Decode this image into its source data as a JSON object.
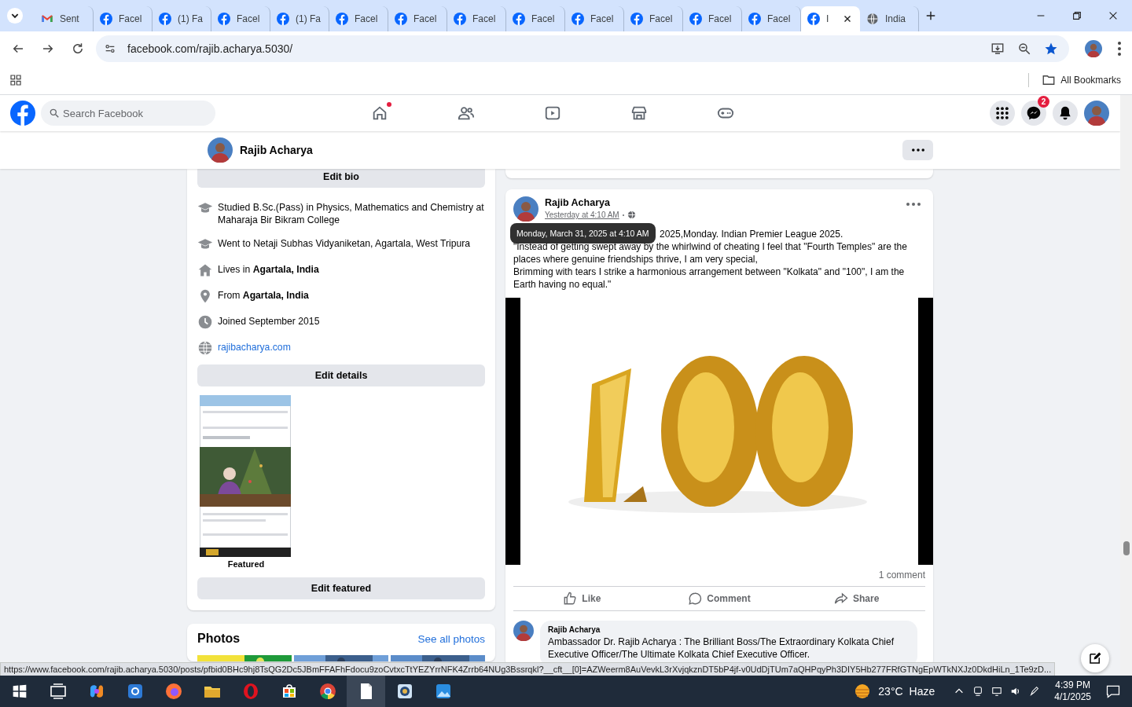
{
  "browser": {
    "tabs": [
      {
        "kind": "gmail",
        "title": "Sent",
        "selected": false
      },
      {
        "kind": "facebook",
        "title": "Facel",
        "selected": false
      },
      {
        "kind": "facebook",
        "title": "(1) Fa",
        "selected": false
      },
      {
        "kind": "facebook",
        "title": "Facel",
        "selected": false
      },
      {
        "kind": "facebook",
        "title": "(1) Fa",
        "selected": false
      },
      {
        "kind": "facebook",
        "title": "Facel",
        "selected": false
      },
      {
        "kind": "facebook",
        "title": "Facel",
        "selected": false
      },
      {
        "kind": "facebook",
        "title": "Facel",
        "selected": false
      },
      {
        "kind": "facebook",
        "title": "Facel",
        "selected": false
      },
      {
        "kind": "facebook",
        "title": "Facel",
        "selected": false
      },
      {
        "kind": "facebook",
        "title": "Facel",
        "selected": false
      },
      {
        "kind": "facebook",
        "title": "Facel",
        "selected": false
      },
      {
        "kind": "facebook",
        "title": "Facel",
        "selected": false
      },
      {
        "kind": "facebook",
        "title": "I",
        "selected": true
      },
      {
        "kind": "globe",
        "title": "India",
        "selected": false
      }
    ],
    "address": "facebook.com/rajib.acharya.5030/",
    "bookmarks_folder": "All Bookmarks"
  },
  "facebook": {
    "search": {
      "placeholder": "Search Facebook"
    },
    "nav": [
      {
        "kind": "home",
        "dot": true
      },
      {
        "kind": "friends",
        "dot": false
      },
      {
        "kind": "video",
        "dot": false
      },
      {
        "kind": "market",
        "dot": false
      },
      {
        "kind": "gaming",
        "dot": false
      }
    ],
    "messenger_badge": "2"
  },
  "profile_bar": {
    "name": "Rajib Acharya"
  },
  "intro": {
    "edit_bio": "Edit bio",
    "items": [
      {
        "kind": "education",
        "text": "Studied B.Sc.(Pass) in Physics, Mathematics and Chemistry at Maharaja Bir Bikram College"
      },
      {
        "kind": "education",
        "text": "Went to Netaji Subhas Vidyaniketan, Agartala, West Tripura"
      },
      {
        "kind": "home",
        "text": "Lives in **Agartala, India**"
      },
      {
        "kind": "location",
        "text": "From **Agartala, India**"
      },
      {
        "kind": "clock",
        "text": "Joined September 2015"
      },
      {
        "kind": "website",
        "text": "rajibacharya.com"
      }
    ],
    "edit_details": "Edit details",
    "featured_label": "Featured",
    "edit_featured": "Edit featured"
  },
  "photos": {
    "title": "Photos",
    "link": "See all photos"
  },
  "post": {
    "author": "Rajib Acharya",
    "time": "Yesterday at 4:10 AM",
    "tooltip": "Monday, March 31, 2025 at 4:10 AM",
    "first_line": "2025,Monday. Indian Premier League 2025.",
    "body": "\"Instead of getting swept away by the whirlwind of cheating I feel that \"Fourth Temples\" are the\nplaces where genuine friendships thrive, I am very special,\nBrimming with tears I strike a harmonious arrangement between \"Kolkata\" and \"100\", I am the\nEarth having no equal.\"",
    "comment_count": "1 comment",
    "actions": [
      {
        "kind": "like",
        "label": "Like"
      },
      {
        "kind": "comment",
        "label": "Comment"
      },
      {
        "kind": "share",
        "label": "Share"
      }
    ],
    "comment": {
      "author": "Rajib Acharya",
      "text": "Ambassador Dr. Rajib Acharya : The Brilliant Boss/The Extraordinary Kolkata Chief\nExecutive Officer/The Ultimate Kolkata Chief Executive Officer."
    }
  },
  "status_url": "https://www.facebook.com/rajib.acharya.5030/posts/pfbid0BHc9hj8TsQG2Dc5JBmFFAFhFdocu9zoCvtxcTtYEZYrrNFK4Zrrb64NUg3Bssrqkl?__cft__[0]=AZWeerm8AuVevkL3rXvjqkznDT5bP4jf-v0UdDjTUm7aQHPqyPh3DIY5Hb277FRfGTNgEpWTkNXJz0DkdHiLn_1Te9zD...",
  "taskbar": {
    "apps": [
      {
        "kind": "taskview",
        "active": false
      },
      {
        "kind": "copilot",
        "active": false
      },
      {
        "kind": "bluebox",
        "active": false
      },
      {
        "kind": "firefox",
        "active": false
      },
      {
        "kind": "folder",
        "active": false
      },
      {
        "kind": "opera",
        "active": false
      },
      {
        "kind": "store",
        "active": false
      },
      {
        "kind": "chrome",
        "active": false
      },
      {
        "kind": "document",
        "active": true
      },
      {
        "kind": "camera",
        "active": false
      },
      {
        "kind": "photos",
        "active": false
      }
    ],
    "temperature": "23°C",
    "condition": "Haze",
    "time": "4:39 PM",
    "date": "4/1/2025"
  }
}
